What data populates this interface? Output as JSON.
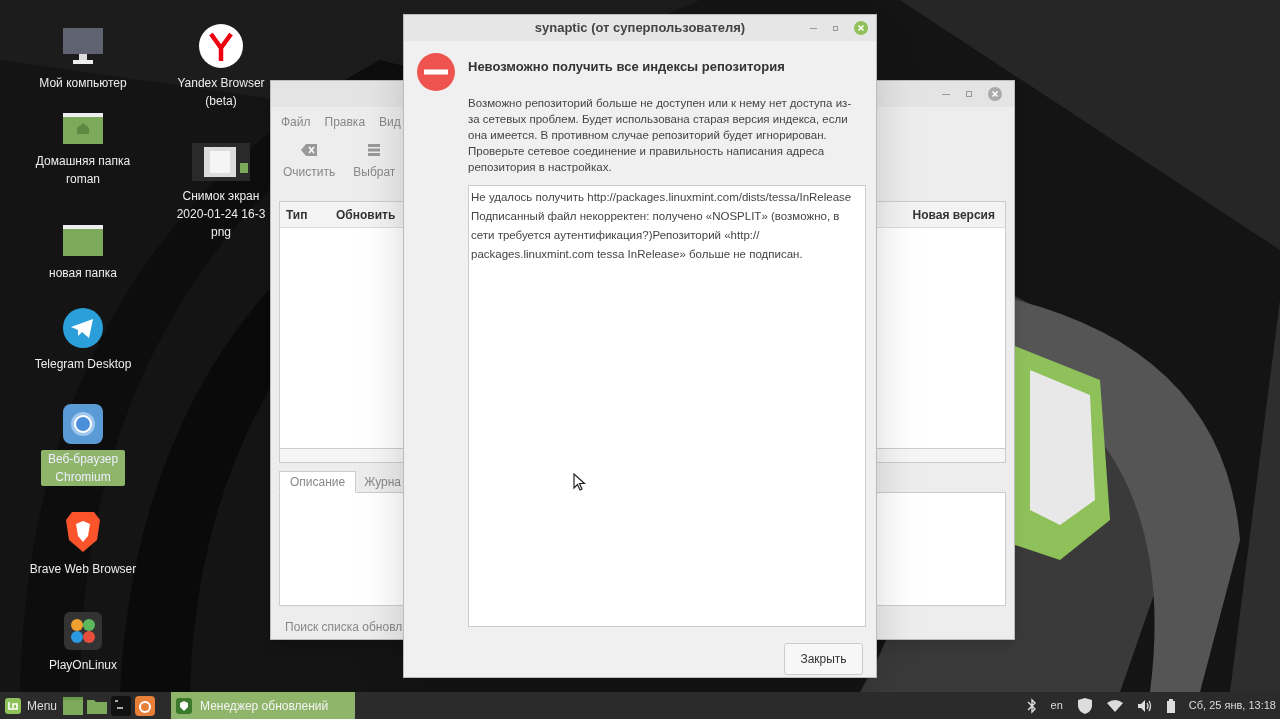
{
  "desktop": {
    "icons": [
      {
        "kind": "computer",
        "label": "Мой компьютер",
        "selected": false
      },
      {
        "kind": "home_folder",
        "label": "Домашняя папка roman",
        "selected": false
      },
      {
        "kind": "folder",
        "label": "новая папка",
        "selected": false
      },
      {
        "kind": "telegram",
        "label": "Telegram Desktop",
        "selected": false
      },
      {
        "kind": "chromium",
        "label": "Веб-браузер Chromium",
        "selected": true
      },
      {
        "kind": "brave",
        "label": "Brave Web Browser",
        "selected": false
      },
      {
        "kind": "playonlinux",
        "label": "PlayOnLinux",
        "selected": false
      },
      {
        "kind": "yandex",
        "label": "Yandex Browser (beta)",
        "selected": false
      },
      {
        "kind": "screenshot",
        "label": "Снимок экран 2020-01-24 16-3 png",
        "selected": false
      }
    ]
  },
  "update_window": {
    "menu": [
      "Файл",
      "Правка",
      "Вид"
    ],
    "toolbar": [
      {
        "kind": "clear",
        "label": "Очистить"
      },
      {
        "kind": "select",
        "label": "Выбрат"
      }
    ],
    "columns": [
      "Тип",
      "Обновить",
      "Новая версия"
    ],
    "tabs": [
      {
        "label": "Описание",
        "selected": true
      },
      {
        "label": "Журна",
        "selected": false
      }
    ],
    "status": "Поиск списка обновл"
  },
  "dialog": {
    "title": "synaptic (от суперпользователя)",
    "heading": "Невозможно получить все индексы репозитория",
    "message": "Возможно репозиторий больше не доступен или к нему нет доступа из-за сетевых проблем. Будет использована старая версия индекса, если она имеется. В противном случае репозиторий будет игнорирован. Проверьте сетевое соединение и правильность написания адреса репозитория в настройках.",
    "details": "Не удалось получить http://packages.linuxmint.com/dists/tessa/InRelease Подписанный файл некорректен: получено «NOSPLIT» (возможно, в сети требуется аутентификация?)Репозиторий «http:// packages.linuxmint.com tessa InRelease» больше не подписан.",
    "button": "Закрыть"
  },
  "taskbar": {
    "menu_label": "Menu",
    "launchers": [
      {
        "kind": "desktop"
      },
      {
        "kind": "files"
      },
      {
        "kind": "terminal"
      },
      {
        "kind": "firefox"
      }
    ],
    "tasks": [
      {
        "label": "Менеджер обновлений",
        "selected": true
      }
    ],
    "tray": {
      "keyboard": "en",
      "clock": "Сб, 25 янв, 13:18"
    }
  }
}
